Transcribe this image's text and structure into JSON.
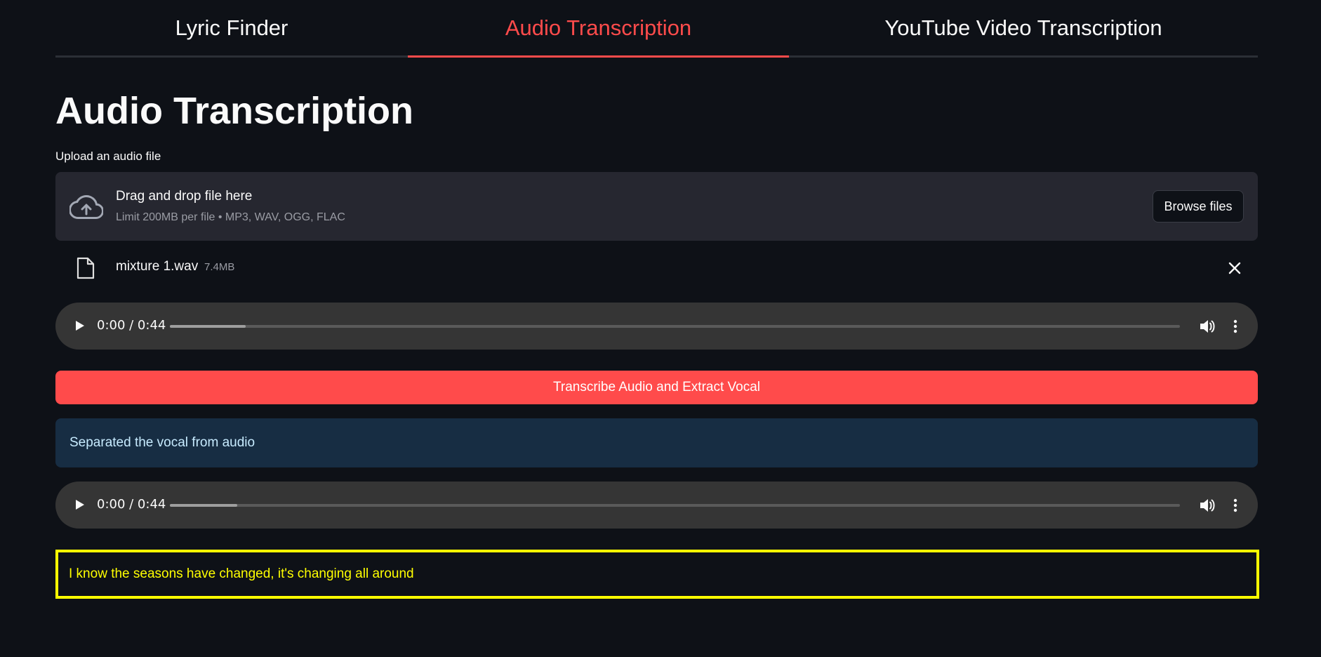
{
  "tabs": [
    {
      "label": "Lyric Finder",
      "active": false
    },
    {
      "label": "Audio Transcription",
      "active": true
    },
    {
      "label": "YouTube Video Transcription",
      "active": false
    }
  ],
  "page": {
    "title": "Audio Transcription"
  },
  "uploader": {
    "label": "Upload an audio file",
    "drop_text": "Drag and drop file here",
    "limit_text": "Limit 200MB per file • MP3, WAV, OGG, FLAC",
    "browse_label": "Browse files",
    "icon": "cloud-upload-icon"
  },
  "uploaded_file": {
    "name": "mixture 1.wav",
    "size": "7.4MB",
    "icon": "file-icon"
  },
  "players": [
    {
      "time": "0:00 / 0:44",
      "buffered_fraction": 0.075
    },
    {
      "time": "0:00 / 0:44",
      "buffered_fraction": 0.067
    }
  ],
  "actions": {
    "transcribe_label": "Transcribe Audio and Extract Vocal"
  },
  "status": {
    "info_text": "Separated the vocal from audio"
  },
  "transcript": {
    "text": "I know the seasons have changed, it's changing all around"
  },
  "colors": {
    "background": "#0e1117",
    "accent": "#ff4b4b",
    "info_bg": "#172d43",
    "info_text": "#c7ebff",
    "transcript_highlight": "#ffff00"
  }
}
